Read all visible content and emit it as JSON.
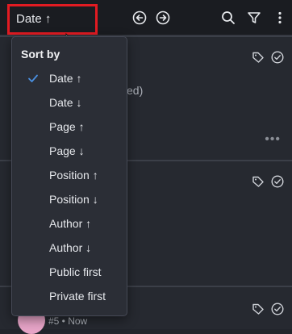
{
  "toolbar": {
    "sort_label": "Date ↑",
    "icons": [
      "arrow-left-circle-icon",
      "arrow-right-circle-icon",
      "search-icon",
      "filter-icon",
      "more-vertical-icon"
    ]
  },
  "background": {
    "partial_text": "ited)",
    "more_dots": "•••",
    "card_meta": "#5 • Now"
  },
  "sort_menu": {
    "title": "Sort by",
    "selected_index": 0,
    "items": [
      {
        "label": "Date ↑"
      },
      {
        "label": "Date ↓"
      },
      {
        "label": "Page ↑"
      },
      {
        "label": "Page ↓"
      },
      {
        "label": "Position ↑"
      },
      {
        "label": "Position ↓"
      },
      {
        "label": "Author ↑"
      },
      {
        "label": "Author ↓"
      },
      {
        "label": "Public first"
      },
      {
        "label": "Private first"
      }
    ]
  },
  "colors": {
    "highlight_border": "#e21b22",
    "check": "#4a90e2",
    "avatar": "#e7a4c7"
  }
}
